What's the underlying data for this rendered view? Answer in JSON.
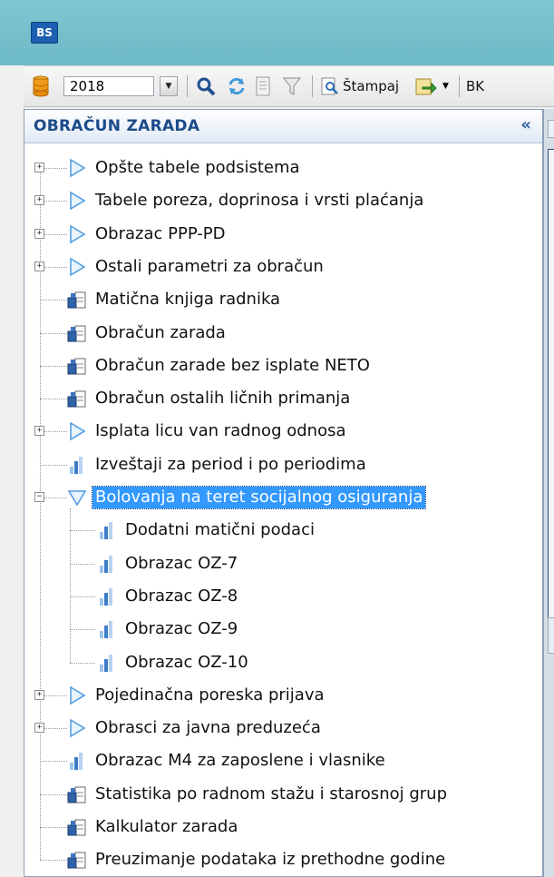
{
  "app": {
    "badge": "BS"
  },
  "toolbar": {
    "year": "2018",
    "print_label": "Štampaj",
    "cut_label": "BK"
  },
  "panel": {
    "title": "OBRAČUN ZARADA",
    "collapse_glyph": "«"
  },
  "tree": [
    {
      "label": "Opšte tabele podsistema",
      "level": 0,
      "icon": "folder-arrow",
      "expander": "+"
    },
    {
      "label": "Tabele poreza, doprinosa i vrsti plaćanja",
      "level": 0,
      "icon": "folder-arrow",
      "expander": "+"
    },
    {
      "label": "Obrazac PPP-PD",
      "level": 0,
      "icon": "folder-arrow",
      "expander": "+"
    },
    {
      "label": "Ostali parametri za obračun",
      "level": 0,
      "icon": "folder-arrow",
      "expander": "+"
    },
    {
      "label": "Matična knjiga radnika",
      "level": 0,
      "icon": "form-icon",
      "expander": ""
    },
    {
      "label": "Obračun zarada",
      "level": 0,
      "icon": "form-icon",
      "expander": ""
    },
    {
      "label": "Obračun zarade bez isplate NETO",
      "level": 0,
      "icon": "form-icon",
      "expander": ""
    },
    {
      "label": "Obračun ostalih ličnih primanja",
      "level": 0,
      "icon": "form-icon",
      "expander": ""
    },
    {
      "label": "Isplata licu van radnog odnosa",
      "level": 0,
      "icon": "folder-arrow",
      "expander": "+"
    },
    {
      "label": "Izveštaji za period i po periodima",
      "level": 0,
      "icon": "report-icon",
      "expander": ""
    },
    {
      "label": "Bolovanja na teret socijalnog osiguranja",
      "level": 0,
      "icon": "folder-arrow-open",
      "expander": "−",
      "selected": true
    },
    {
      "label": "Dodatni matični podaci",
      "level": 1,
      "icon": "report-icon",
      "expander": ""
    },
    {
      "label": "Obrazac OZ-7",
      "level": 1,
      "icon": "report-icon",
      "expander": ""
    },
    {
      "label": "Obrazac OZ-8",
      "level": 1,
      "icon": "report-icon",
      "expander": ""
    },
    {
      "label": "Obrazac OZ-9",
      "level": 1,
      "icon": "report-icon",
      "expander": ""
    },
    {
      "label": "Obrazac OZ-10",
      "level": 1,
      "icon": "report-icon",
      "expander": ""
    },
    {
      "label": "Pojedinačna poreska prijava",
      "level": 0,
      "icon": "folder-arrow",
      "expander": "+"
    },
    {
      "label": "Obrasci za javna preduzeća",
      "level": 0,
      "icon": "folder-arrow",
      "expander": "+"
    },
    {
      "label": "Obrazac M4 za zaposlene i vlasnike",
      "level": 0,
      "icon": "report-icon",
      "expander": ""
    },
    {
      "label": "Statistika po radnom stažu i starosnoj grup",
      "level": 0,
      "icon": "form-icon",
      "expander": ""
    },
    {
      "label": "Kalkulator zarada",
      "level": 0,
      "icon": "form-icon",
      "expander": ""
    },
    {
      "label": "Preuzimanje podataka iz prethodne godine",
      "level": 0,
      "icon": "form-icon",
      "expander": ""
    }
  ]
}
